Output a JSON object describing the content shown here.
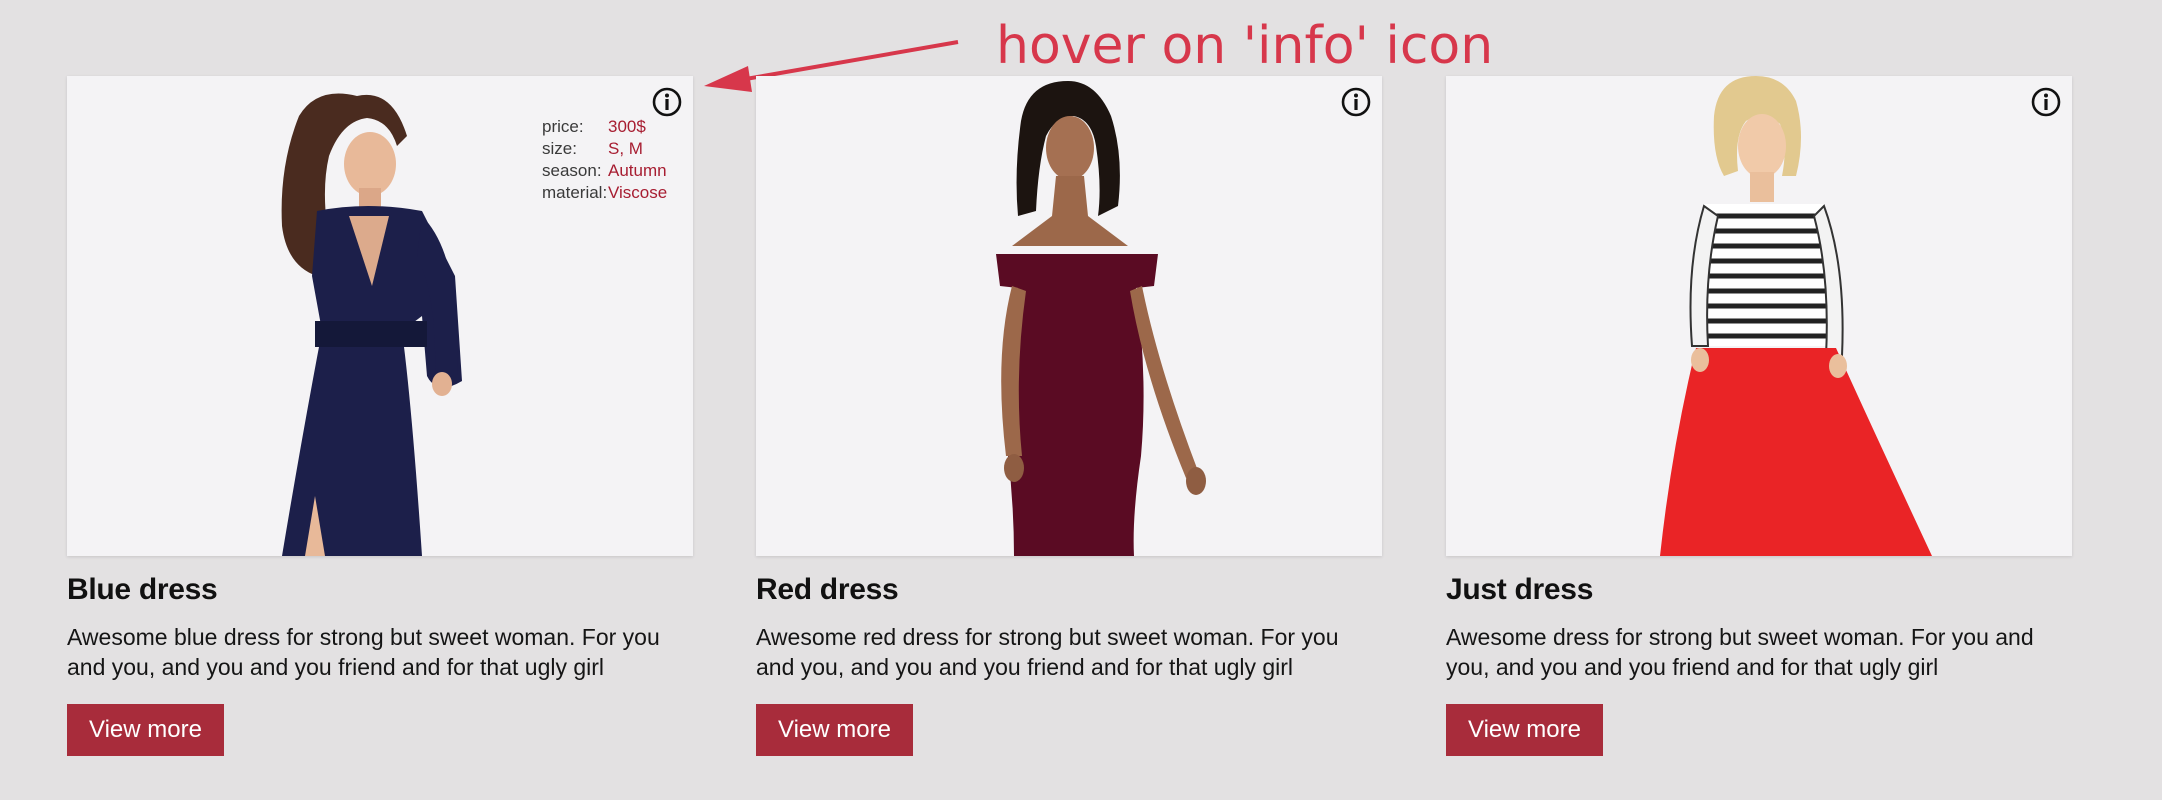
{
  "annotation": {
    "text": "hover on 'info' icon",
    "color": "#d7374b"
  },
  "colors": {
    "background": "#e3e1e2",
    "accent": "#a82c3b",
    "info_value": "#a71d31"
  },
  "products": [
    {
      "title": "Blue dress",
      "description": "Awesome blue dress for strong but sweet woman. For you and you, and you and you friend and for that ugly girl",
      "button": "View more",
      "image_icon": "model-blue-dress",
      "info_visible": true,
      "info": [
        {
          "key": "price:",
          "value": "300$"
        },
        {
          "key": "size:",
          "value": "S, M"
        },
        {
          "key": "season:",
          "value": "Autumn"
        },
        {
          "key": "material:",
          "value": "Viscose"
        }
      ]
    },
    {
      "title": "Red dress",
      "description": "Awesome red dress for strong but sweet woman. For you and you, and you and you friend and for that ugly girl",
      "button": "View more",
      "image_icon": "model-red-dress",
      "info_visible": false
    },
    {
      "title": "Just dress",
      "description": "Awesome dress for strong but sweet woman. For you and you, and you and you friend and for that ugly girl",
      "button": "View more",
      "image_icon": "model-striped-top-red-skirt",
      "info_visible": false
    }
  ]
}
